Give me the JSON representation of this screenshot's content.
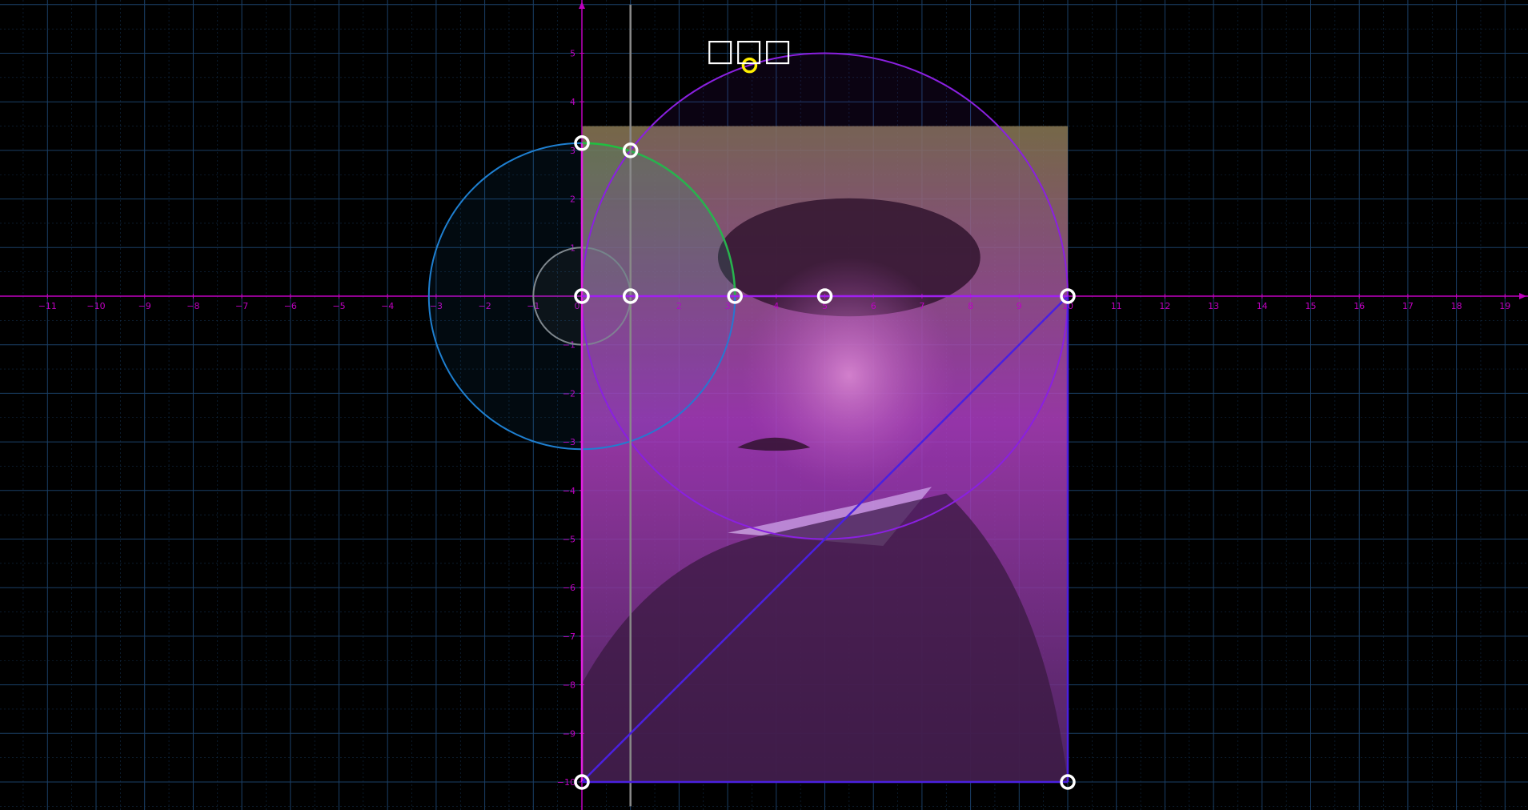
{
  "canvas": {
    "background": "#000000",
    "title": "□□□"
  },
  "coordinate_plane": {
    "x_range": [
      -12,
      19.5
    ],
    "y_range": [
      -10.5,
      6
    ],
    "grid": true,
    "minor_grid": true,
    "grid_color": "#1a3f66",
    "axis_color": "#c000c0",
    "x_ticks": [
      -11,
      -10,
      -9,
      -8,
      -7,
      -6,
      -5,
      -4,
      -3,
      -2,
      -1,
      0,
      1,
      2,
      3,
      4,
      5,
      6,
      7,
      8,
      9,
      10,
      11,
      12,
      13,
      14,
      15,
      16,
      17,
      18,
      19
    ],
    "y_ticks": [
      5,
      4,
      3,
      2,
      1,
      -1,
      -2,
      -3,
      -4,
      -5,
      -6,
      -7,
      -8,
      -9,
      -10
    ]
  },
  "portrait": {
    "description_icon": "portrait-photo",
    "x_range": [
      0,
      10
    ],
    "y_range": [
      -10,
      3.5
    ],
    "tint_top": "#8a7a55",
    "tint_mid": "#b040c0",
    "tint_bottom": "#5a2a70"
  },
  "circles": [
    {
      "name": "small-gray-circle",
      "cx": 0,
      "cy": 0,
      "r": 1,
      "color": "#888888"
    },
    {
      "name": "blue-circle",
      "cx": 0,
      "cy": 0,
      "r": 3.15,
      "color": "#1e7fd0"
    },
    {
      "name": "green-arc",
      "cx": 0,
      "cy": 0,
      "r": 3.15,
      "color": "#20c040",
      "arc": [
        0,
        90
      ]
    },
    {
      "name": "purple-circle",
      "cx": 5,
      "cy": 0,
      "r": 5,
      "color": "#8a20e0"
    }
  ],
  "lines": [
    {
      "name": "vertical-guide-line",
      "x1": 1,
      "y1": 6,
      "x2": 1,
      "y2": -10.5,
      "color": "#888888"
    },
    {
      "name": "diagonal-line",
      "x1": 0,
      "y1": -10,
      "x2": 10,
      "y2": 0,
      "color": "#4a20e0"
    },
    {
      "name": "rect-left-edge",
      "x1": 0,
      "y1": 3.15,
      "x2": 0,
      "y2": -10,
      "color": "#e020e0"
    },
    {
      "name": "rect-right-edge",
      "x1": 10,
      "y1": 0,
      "x2": 10,
      "y2": -10,
      "color": "#4a20e0"
    },
    {
      "name": "rect-bottom-edge",
      "x1": 0,
      "y1": -10,
      "x2": 10,
      "y2": -10,
      "color": "#4a20e0"
    },
    {
      "name": "x-axis-highlight",
      "x1": 0,
      "y1": 0,
      "x2": 10,
      "y2": 0,
      "color": "#a020f0"
    }
  ],
  "points": [
    {
      "name": "point-origin",
      "x": 0,
      "y": 0,
      "color": "#ffffff"
    },
    {
      "name": "point-a",
      "x": 1,
      "y": 0,
      "color": "#ffffff"
    },
    {
      "name": "point-b",
      "x": 3.15,
      "y": 0,
      "color": "#ffffff"
    },
    {
      "name": "point-c",
      "x": 5,
      "y": 0,
      "color": "#ffffff"
    },
    {
      "name": "point-d",
      "x": 10,
      "y": 0,
      "color": "#ffffff"
    },
    {
      "name": "point-top-y",
      "x": 0,
      "y": 3.15,
      "color": "#ffffff"
    },
    {
      "name": "point-arc",
      "x": 1,
      "y": 3,
      "color": "#ffffff"
    },
    {
      "name": "point-bottom-left",
      "x": 0,
      "y": -10,
      "color": "#ffffff"
    },
    {
      "name": "point-bottom-right",
      "x": 10,
      "y": -10,
      "color": "#ffffff"
    },
    {
      "name": "point-yellow",
      "x": 3.45,
      "y": 4.75,
      "color": "#ffee00"
    }
  ]
}
